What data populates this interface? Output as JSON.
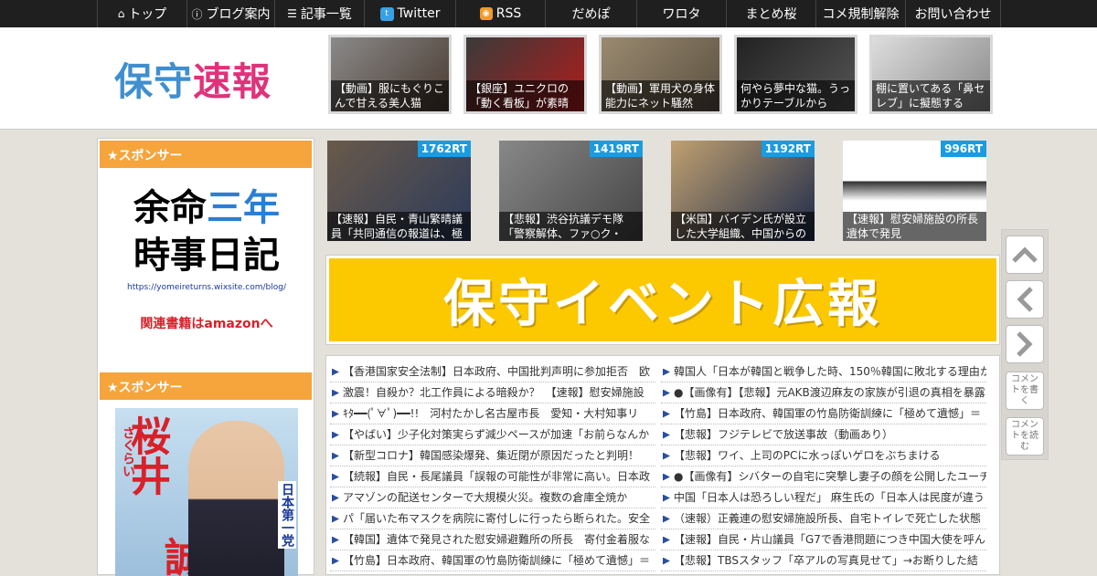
{
  "nav": [
    {
      "icon": "home-icon",
      "label": "トップ",
      "w": 98
    },
    {
      "icon": "info-icon",
      "label": "ブログ案内",
      "w": 96
    },
    {
      "icon": "list-icon",
      "label": "記事一覧",
      "w": 98
    },
    {
      "icon": "twitter-icon",
      "label": "Twitter",
      "w": 100
    },
    {
      "icon": "rss-icon",
      "label": "RSS",
      "w": 98
    },
    {
      "icon": "",
      "label": "だめぽ",
      "w": 100
    },
    {
      "icon": "",
      "label": "ワロタ",
      "w": 98
    },
    {
      "icon": "",
      "label": "まとめ桜",
      "w": 98
    },
    {
      "icon": "",
      "label": "コメ規制解除",
      "w": 98
    },
    {
      "icon": "",
      "label": "お問い合わせ",
      "w": 105
    }
  ],
  "logo": {
    "part1": "保守",
    "part2": "速報"
  },
  "header_thumbs": [
    {
      "caption": "【動画】服にもぐりこんで甘える美人猫"
    },
    {
      "caption": "【銀座】ユニクロの「動く看板」が素晴"
    },
    {
      "caption": "【動画】軍用犬の身体能力にネット騒然"
    },
    {
      "caption": "何やら夢中な猫。うっかりテーブルから"
    },
    {
      "caption": "棚に置いてある「鼻セレブ」に擬態する"
    }
  ],
  "sidebar": {
    "sponsor_label": "★スポンサー",
    "book1": {
      "line1a": "余命",
      "line1b": "三年",
      "line2": "時事日記",
      "url": "https://yomeireturns.wixsite.com/blog/",
      "amazon": "関連書籍はamazonへ"
    },
    "book2": {
      "name": "桜井",
      "name2": "誠",
      "reading": "さくらい",
      "party": "日本第一党"
    }
  },
  "ranking": [
    {
      "count": "1762RT",
      "caption": "【速報】自民・青山繁晴議員「共同通信の報道は、極"
    },
    {
      "count": "1419RT",
      "caption": "【悲報】渋谷抗議デモ隊「警察解体、ファ○ク・ザ・"
    },
    {
      "count": "1192RT",
      "caption": "【米国】バイデン氏が設立した大学組織、中国からの"
    },
    {
      "count": "996RT",
      "caption": "【速報】慰安婦施設の所長 遺体で発見"
    }
  ],
  "event_banner": "保守イベント広報",
  "news_left": [
    "【香港国家安全法制】日本政府、中国批判声明に参加拒否　欧",
    "激震！自殺か？北工作員による暗殺か？　【速報】慰安婦施設",
    "ｷﾀ━━(ﾟ∀ﾟ)━━!!　河村たかし名古屋市長　愛知・大村知事リ",
    "【やばい】少子化対策実らず減少ペースが加速「お前らなんか",
    "【新型コロナ】韓国感染爆発、集近閉が原因だったと判明！",
    "【続報】自民・長尾議員「誤報の可能性が非常に高い。日本政",
    "アマゾンの配送センターで大規模火災。複数の倉庫全焼か",
    "パ「届いた布マスクを病院に寄付しに行ったら断られた。安全",
    "【韓国】遺体で発見された慰安婦避難所の所長　寄付金着服な",
    "【竹島】日本政府、韓国軍の竹島防衛訓練に「極めて遺憾」＝"
  ],
  "news_right": [
    "韓国人「日本が韓国と戦争した時、150％韓国に敗北する理由か",
    "●【画像有】【悲報】元AKB渡辺麻友の家族が引退の真相を暴露",
    "【竹島】日本政府、韓国軍の竹島防衛訓練に「極めて遺憾」＝",
    "【悲報】フジテレビで放送事故（動画あり）",
    "【悲報】ワイ、上司のPCに水っぽいゲロをぶちまける",
    "●【画像有】シバターの自宅に突撃し妻子の顔を公開したユーチ",
    "中国「日本人は恐ろしい程だ」 麻生氏の「日本人は民度が違う",
    "（速報）正義連の慰安婦施設所長、自宅トイレで死亡した状態",
    "【速報】自民・片山議員「G7で香港問題につき中国大使を呼ん",
    "【悲報】TBSスタッフ「卒アルの写真見せて」→お断りした結"
  ],
  "side_buttons": {
    "comment_write": "コメントを書く",
    "comment_read": "コメントを読む"
  },
  "colors": {
    "nav_bg": "#1f1f1f",
    "sponsor": "#f6a43c",
    "rt_badge": "#1b9be0",
    "event": "#fcc800"
  }
}
